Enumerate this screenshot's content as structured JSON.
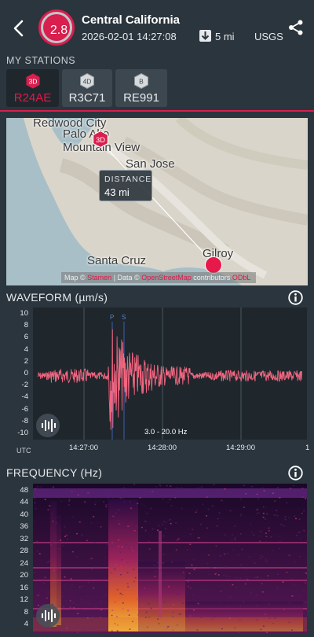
{
  "header": {
    "magnitude": "2.8",
    "region": "Central California",
    "datetime": "2026-02-01 14:27:08",
    "depth": "5 mi",
    "source": "USGS"
  },
  "stations": {
    "title": "MY STATIONS",
    "items": [
      {
        "badge": "3D",
        "label": "R24AE",
        "active": true
      },
      {
        "badge": "4D",
        "label": "R3C71",
        "active": false
      },
      {
        "badge": "B",
        "label": "RE991",
        "active": false
      }
    ]
  },
  "map": {
    "cities": [
      "Redwood City",
      "Palo Alto",
      "Mountain View",
      "San Jose",
      "Santa Cruz",
      "Gilroy"
    ],
    "distance_title": "DISTANCE",
    "distance_value": "43 mi",
    "attribution_prefix": "Map ©",
    "attribution_map_link": "Stamen",
    "attribution_mid": "| Data ©",
    "attribution_data_link": "OpenStreetMap",
    "attribution_suffix": "contributors",
    "attribution_license": "ODbL"
  },
  "waveform": {
    "title": "WAVEFORM (µm/s)",
    "utc_label": "UTC",
    "filter_label": "3.0 - 20.0 Hz",
    "phase_labels": [
      "P",
      "S"
    ],
    "y_ticks": [
      "10",
      "8",
      "6",
      "4",
      "2",
      "0",
      "-2",
      "-4",
      "-6",
      "-8",
      "-10"
    ],
    "x_ticks": [
      "14:27:00",
      "14:28:00",
      "14:29:00",
      "1"
    ]
  },
  "frequency": {
    "title": "FREQUENCY (Hz)",
    "y_ticks": [
      "48",
      "44",
      "40",
      "36",
      "32",
      "28",
      "24",
      "20",
      "16",
      "12",
      "8",
      "4"
    ]
  },
  "colors": {
    "accent": "#d81f4e",
    "background": "#2b353d",
    "plot_bg": "#1f272d",
    "wave": "#f26680"
  },
  "icons": {
    "back": "chevron-left-icon",
    "share": "share-icon",
    "depth": "arrow-down-icon",
    "info": "info-icon",
    "sound": "sound-wave-icon"
  }
}
